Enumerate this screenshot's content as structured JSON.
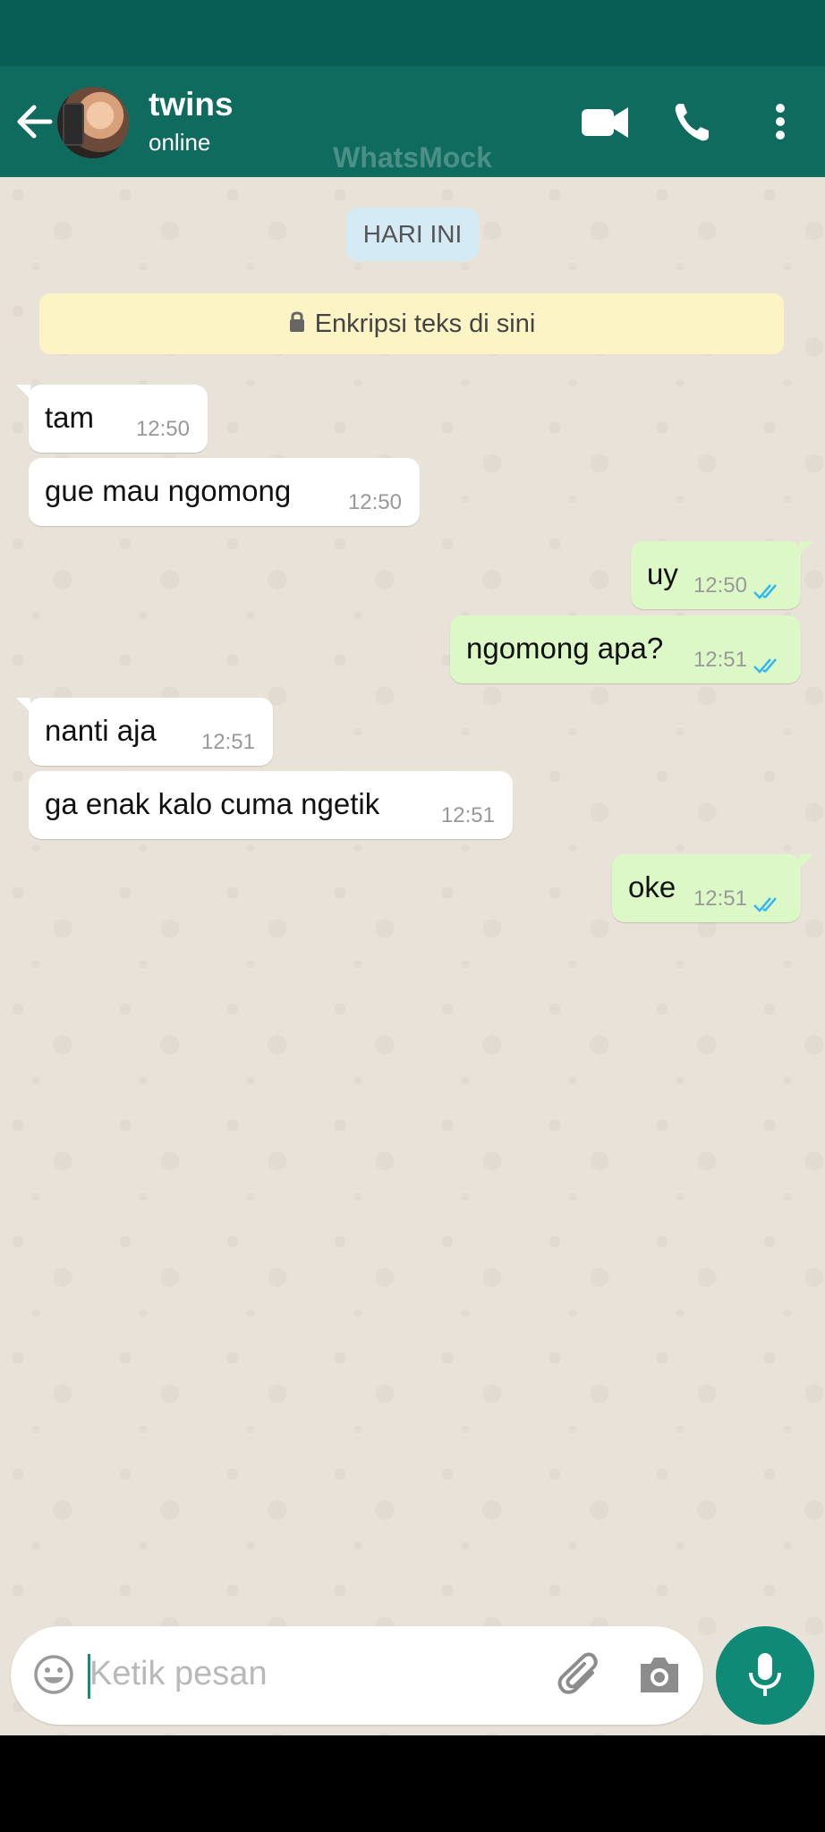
{
  "header": {
    "contact_name": "twins",
    "status": "online",
    "watermark": "WhatsMock",
    "accent": "#0e6b5e"
  },
  "chat": {
    "date_chip": "HARI INI",
    "encryption_notice": "Enkripsi teks di sini",
    "messages": [
      {
        "dir": "in",
        "text": "tam",
        "time": "12:50"
      },
      {
        "dir": "in",
        "text": "gue mau ngomong",
        "time": "12:50"
      },
      {
        "dir": "out",
        "text": "uy",
        "time": "12:50",
        "read": true
      },
      {
        "dir": "out",
        "text": "ngomong apa?",
        "time": "12:51",
        "read": true
      },
      {
        "dir": "in",
        "text": "nanti aja",
        "time": "12:51"
      },
      {
        "dir": "in",
        "text": "ga enak kalo cuma ngetik",
        "time": "12:51"
      },
      {
        "dir": "out",
        "text": "oke",
        "time": "12:51",
        "read": true
      }
    ]
  },
  "composer": {
    "placeholder": "Ketik pesan"
  },
  "icons": {
    "back": "back-arrow-icon",
    "video": "video-call-icon",
    "call": "phone-icon",
    "menu": "more-vert-icon",
    "emoji": "emoji-icon",
    "attach": "paperclip-icon",
    "camera": "camera-icon",
    "mic": "microphone-icon",
    "lock": "lock-icon",
    "ticks": "double-check-icon"
  }
}
